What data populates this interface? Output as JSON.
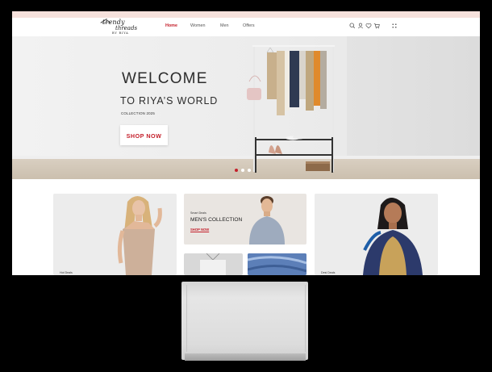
{
  "brand": {
    "line1": "trendy",
    "line2": "threads",
    "line3": "BY RIYA"
  },
  "nav": {
    "items": [
      {
        "label": "Home"
      },
      {
        "label": "Women"
      },
      {
        "label": "Men"
      },
      {
        "label": "Offers"
      }
    ],
    "active": "Home",
    "icons": [
      "search-icon",
      "user-icon",
      "heart-icon",
      "cart-icon",
      "grid-menu-icon"
    ]
  },
  "hero": {
    "title": "WELCOME",
    "subtitle": "TO RIYA’S WORLD",
    "collection": "COLLECTION 2025",
    "cta": "SHOP NOW",
    "slides": 3,
    "active_slide": 1
  },
  "cards": {
    "hot_deals": "Hot Deals",
    "mens_small": "Smart Deals",
    "mens_title": "MEN'S COLLECTION",
    "mens_link": "SHOP NOW",
    "desi_deals": "Desi Deals"
  },
  "colors": {
    "accent": "#c4202b",
    "top_strip": "#f6e1dc",
    "background": "#000000"
  }
}
